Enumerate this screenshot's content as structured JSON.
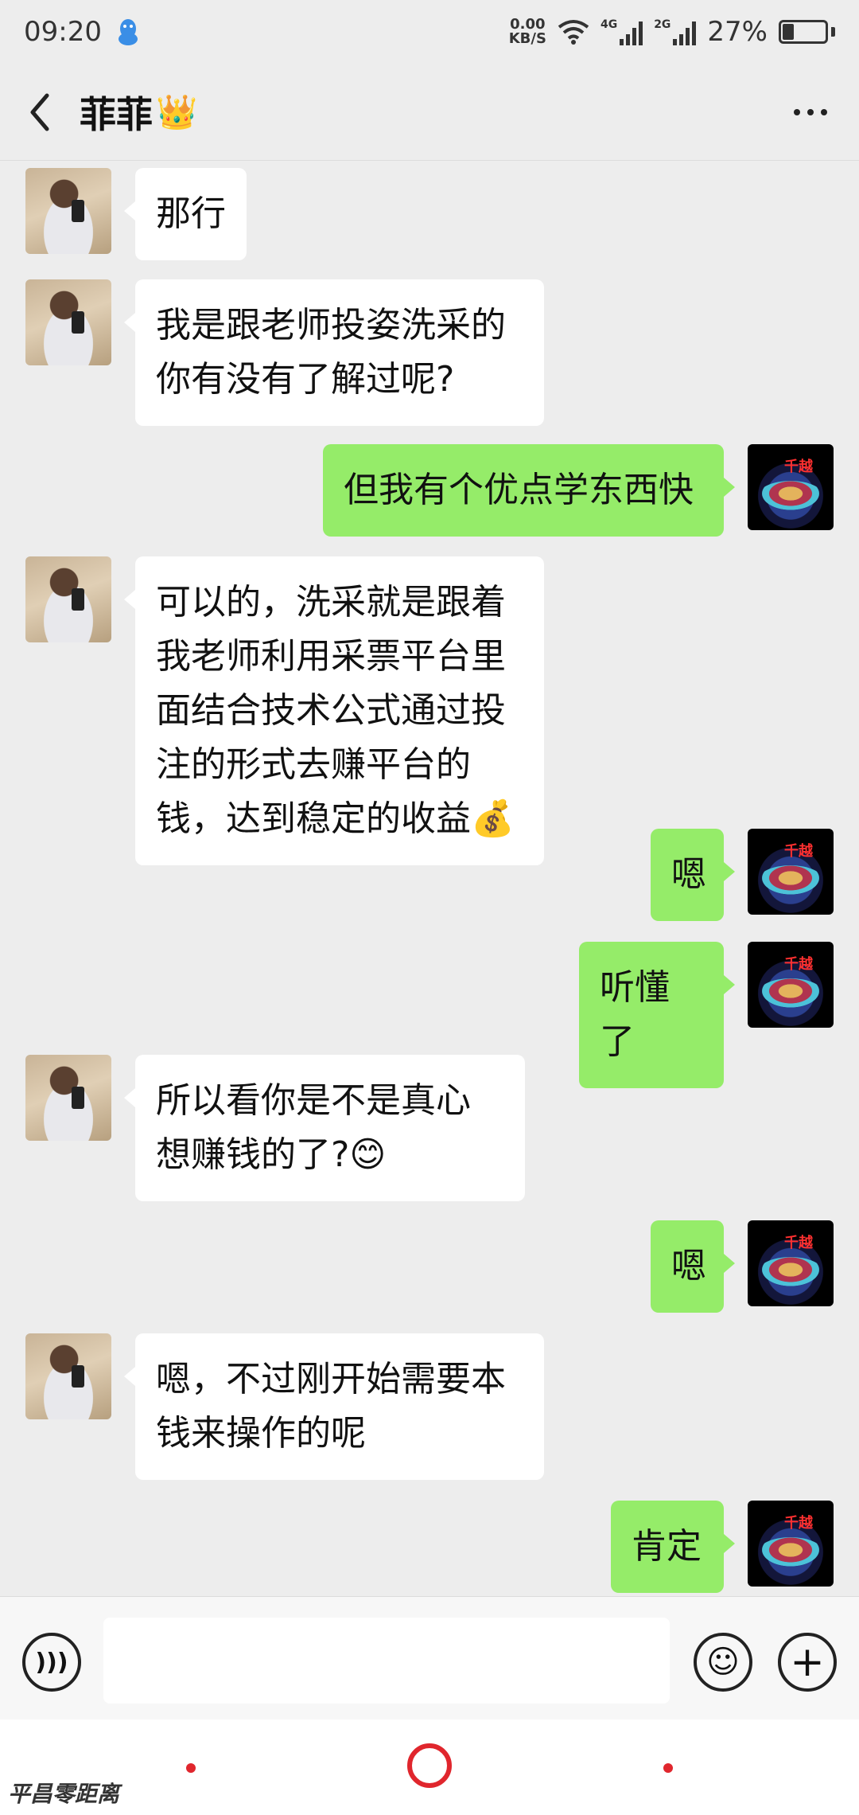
{
  "status_bar": {
    "time": "09:20",
    "app_icon": "qq-penguin-icon",
    "net_speed_value": "0.00",
    "net_speed_unit": "KB/S",
    "sim1_label": "4G",
    "sim2_label": "2G",
    "battery_percent": "27%",
    "battery_level": 0.27
  },
  "header": {
    "title": "菲菲",
    "title_emoji": "👑",
    "back_icon": "chevron-left-icon",
    "more_icon": "more-dots-icon"
  },
  "messages": [
    {
      "side": "left",
      "text": "那行"
    },
    {
      "side": "left",
      "text": "我是跟老师投姿洗采的  你有没有了解过呢?"
    },
    {
      "side": "right",
      "text": "但我有个优点学东西快"
    },
    {
      "side": "left",
      "text": "可以的，洗采就是跟着我老师利用采票平台里面结合技术公式通过投注的形式去赚平台的钱，达到稳定的收益💰"
    },
    {
      "side": "right",
      "text": "嗯"
    },
    {
      "side": "right",
      "text": "听懂了"
    },
    {
      "side": "left",
      "text": "所以看你是不是真心想赚钱的了?😊"
    },
    {
      "side": "right",
      "text": "嗯"
    },
    {
      "side": "left",
      "text": "嗯，不过刚开始需要本钱来操作的呢"
    },
    {
      "side": "right",
      "text": "肯定"
    }
  ],
  "my_avatar_label": "千越",
  "input_bar": {
    "voice_icon": "voice-icon",
    "emoji_icon": "emoji-smile-icon",
    "plus_icon": "plus-circle-icon",
    "input_value": ""
  },
  "nav": {
    "accent_color": "#e0262d"
  },
  "watermark": "平昌零距离",
  "colors": {
    "bubble_me": "#95ec69",
    "bubble_other": "#ffffff",
    "background": "#ededed"
  }
}
